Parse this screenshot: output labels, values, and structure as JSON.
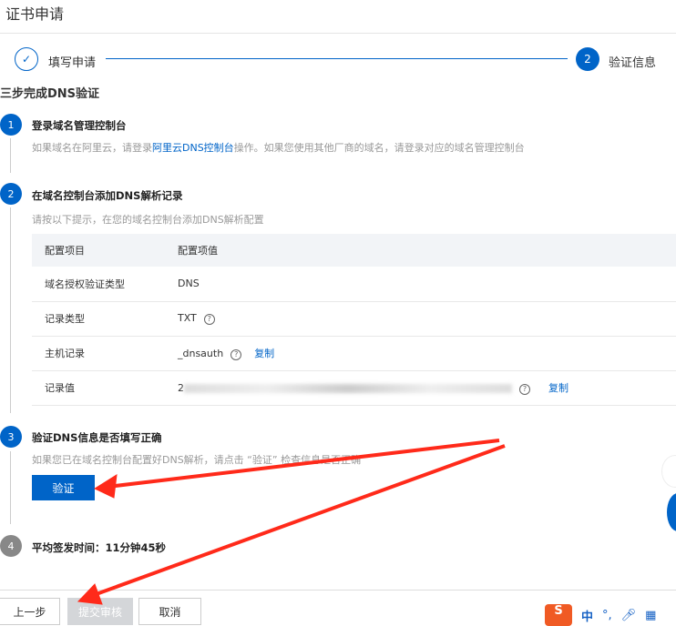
{
  "header": {
    "title": "证书申请"
  },
  "steps": [
    {
      "label": "填写申请",
      "icon": "check-icon"
    },
    {
      "number": "2",
      "label": "验证信息"
    }
  ],
  "section_title": "三步完成DNS验证",
  "step1": {
    "number": "1",
    "title": "登录域名管理控制台",
    "desc_before": "如果域名在阿里云，请登录",
    "link": "阿里云DNS控制台",
    "desc_after": "操作。如果您使用其他厂商的域名，请登录对应的域名管理控制台"
  },
  "step2": {
    "number": "2",
    "title": "在域名控制台添加DNS解析记录",
    "desc": "请按以下提示，在您的域名控制台添加DNS解析配置"
  },
  "table": {
    "headers": [
      "配置项目",
      "配置项值"
    ],
    "rows": [
      {
        "name": "域名授权验证类型",
        "value": "DNS"
      },
      {
        "name": "记录类型",
        "value": "TXT",
        "help": "?"
      },
      {
        "name": "主机记录",
        "value": "_dnsauth",
        "help": "?",
        "copy": "复制"
      },
      {
        "name": "记录值",
        "value": "2",
        "help": "?",
        "copy": "复制"
      }
    ]
  },
  "step3": {
    "number": "3",
    "title": "验证DNS信息是否填写正确",
    "desc": "如果您已在域名控制台配置好DNS解析，请点击 “验证” 检查信息是否正确",
    "button": "验证"
  },
  "step4": {
    "number": "4",
    "title": "平均签发时间：11分钟45秒"
  },
  "footer": {
    "prev": "上一步",
    "submit": "提交审核",
    "cancel": "取消"
  },
  "ime": {
    "logo": "S",
    "lang": "中",
    "punct": "°,"
  },
  "colors": {
    "primary": "#0064c8",
    "annotation": "#ff2a1a"
  }
}
